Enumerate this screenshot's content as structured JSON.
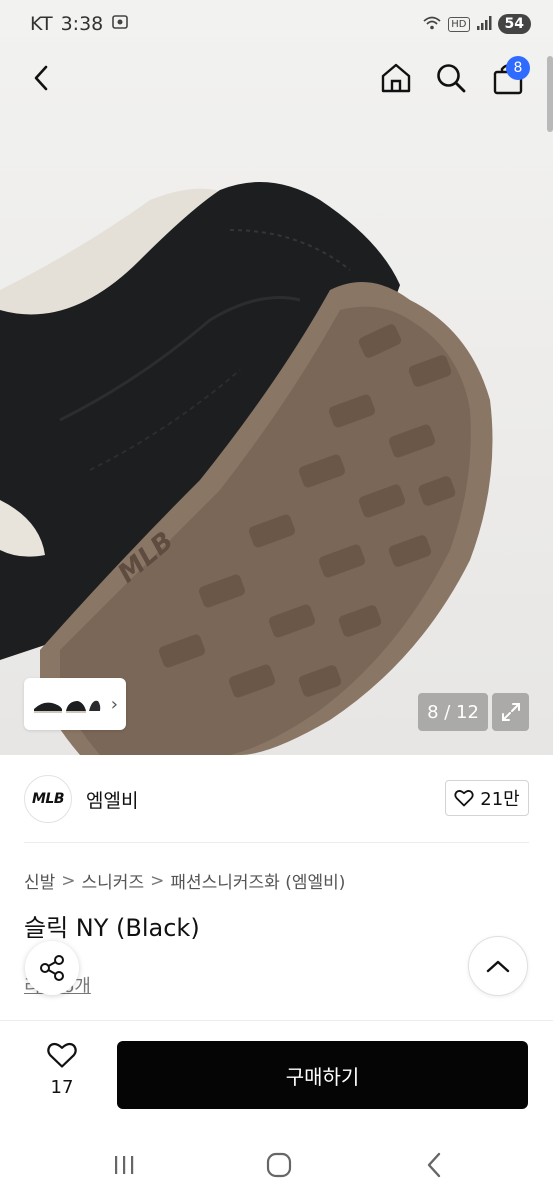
{
  "status_bar": {
    "carrier": "KT",
    "time": "3:38",
    "hd_label": "HD",
    "battery": "54"
  },
  "header": {
    "back_icon": "chevron-left-icon",
    "home_icon": "home-icon",
    "search_icon": "search-icon",
    "cart_icon": "shopping-bag-icon",
    "cart_count": "8",
    "badge_color": "#2f6bff"
  },
  "gallery": {
    "counter": "8 / 12",
    "current_index": 8,
    "total": 12,
    "expand_icon": "expand-icon",
    "thumb_arrow": "›"
  },
  "brand": {
    "logo_text": "MLB",
    "name": "엠엘비",
    "like_count": "21만"
  },
  "breadcrumb": {
    "items": [
      "신발",
      "스니커즈",
      "패션스니커즈화 (엠엘비)"
    ],
    "separator": ">"
  },
  "product": {
    "title": "슬릭 NY (Black)",
    "review_text": "리뷰 6개"
  },
  "actions": {
    "wish_count": "17",
    "buy_label": "구매하기"
  }
}
